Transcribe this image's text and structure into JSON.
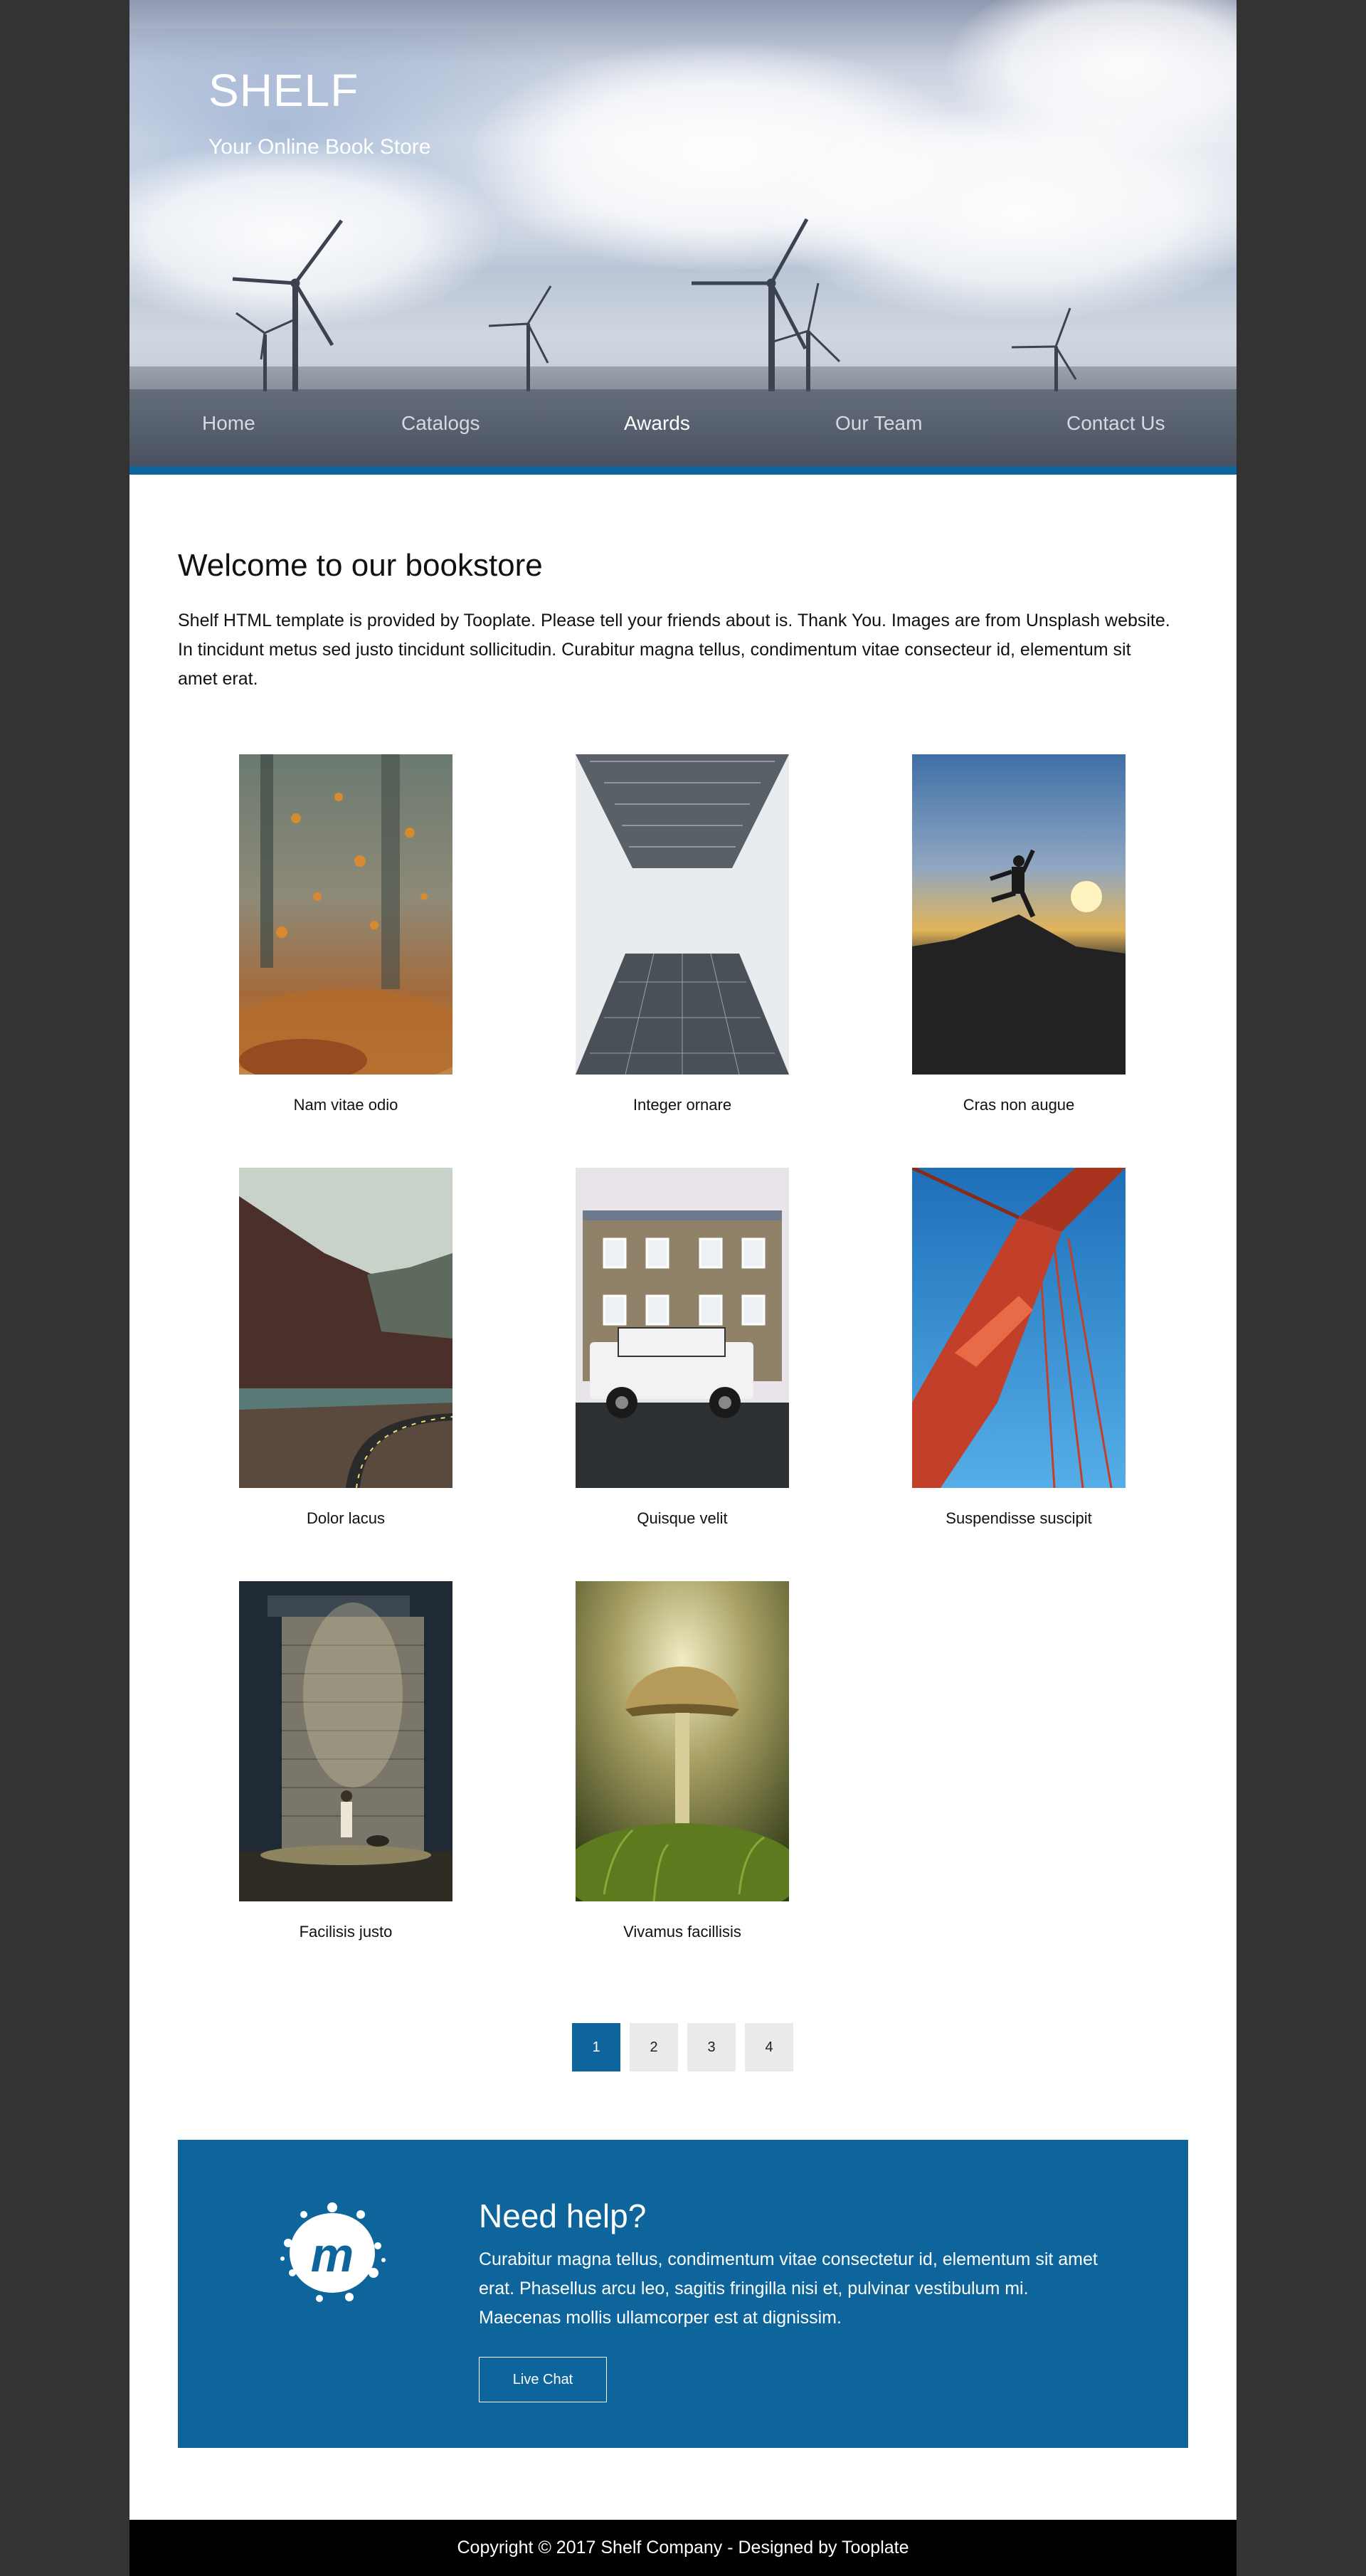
{
  "site": {
    "brand": "SHELF",
    "tagline": "Your Online Book Store"
  },
  "nav": {
    "items": [
      {
        "label": "Home"
      },
      {
        "label": "Catalogs"
      },
      {
        "label": "Awards",
        "active": true
      },
      {
        "label": "Our Team"
      },
      {
        "label": "Contact Us"
      }
    ]
  },
  "welcome": {
    "title": "Welcome to our bookstore",
    "text": "Shelf HTML template is provided by Tooplate. Please tell your friends about is. Thank You. Images are from Unsplash website. In tincidunt metus sed justo tincidunt sollicitudin. Curabitur magna tellus, condimentum vitae consecteur id, elementum sit amet erat."
  },
  "gallery": {
    "items": [
      {
        "caption": "Nam vitae odio",
        "image": "autumn-leaves-photo"
      },
      {
        "caption": "Integer ornare",
        "image": "skyscrapers-photo"
      },
      {
        "caption": "Cras non augue",
        "image": "sunset-jump-photo"
      },
      {
        "caption": "Dolor lacus",
        "image": "mountain-road-photo"
      },
      {
        "caption": "Quisque velit",
        "image": "house-jeep-photo"
      },
      {
        "caption": "Suspendisse suscipit",
        "image": "red-bridge-photo"
      },
      {
        "caption": "Facilisis justo",
        "image": "wall-child-photo"
      },
      {
        "caption": "Vivamus facillisis",
        "image": "mushroom-photo"
      }
    ]
  },
  "pagination": {
    "pages": [
      "1",
      "2",
      "3",
      "4"
    ],
    "current": "1"
  },
  "help": {
    "title": "Need help?",
    "text": "Curabitur magna tellus, condimentum vitae consectetur id, elementum sit amet erat. Phasellus arcu leo, sagitis fringilla nisi et, pulvinar vestibulum mi. Maecenas mollis ullamcorper est at dignissim.",
    "button_label": "Live Chat",
    "logo": "meetup-logo-icon"
  },
  "footer": {
    "text": "Copyright © 2017 Shelf Company - Designed by Tooplate"
  },
  "colors": {
    "primary": "#0e659c",
    "background": "#333333",
    "footer": "#000000",
    "pager_inactive": "#eaeaea"
  }
}
